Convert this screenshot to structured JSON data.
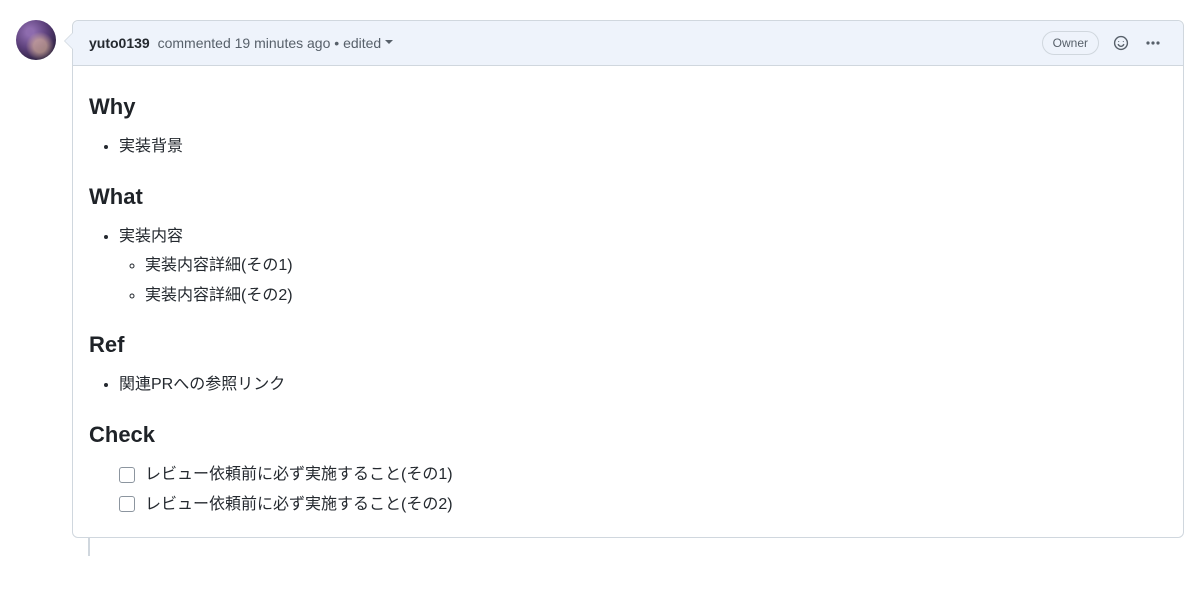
{
  "header": {
    "author": "yuto0139",
    "meta_prefix": " commented ",
    "timestamp": "19 minutes ago",
    "meta_middle": " • ",
    "edited": "edited",
    "badge": "Owner"
  },
  "sections": {
    "why": {
      "title": "Why",
      "items": [
        "実装背景"
      ]
    },
    "what": {
      "title": "What",
      "items": [
        "実装内容"
      ],
      "subitems": [
        "実装内容詳細(その1)",
        "実装内容詳細(その2)"
      ]
    },
    "ref": {
      "title": "Ref",
      "items": [
        "関連PRへの参照リンク"
      ]
    },
    "check": {
      "title": "Check",
      "tasks": [
        "レビュー依頼前に必ず実施すること(その1)",
        "レビュー依頼前に必ず実施すること(その2)"
      ]
    }
  }
}
